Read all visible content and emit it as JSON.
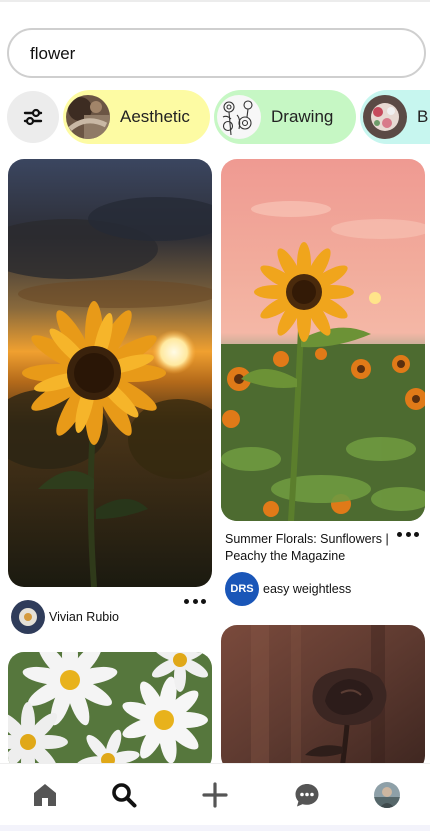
{
  "search": {
    "value": "flower",
    "placeholder": ""
  },
  "chips": [
    {
      "label": "Aesthetic",
      "color": "#fdfba3"
    },
    {
      "label": "Drawing",
      "color": "#c6f7c4"
    },
    {
      "label": "B",
      "color": "#c7f6ef"
    }
  ],
  "pins": [
    {
      "image": "sunflower-sunset",
      "author": "Vivian Rubio"
    },
    {
      "image": "sunflower-field-pink-sky",
      "title": "Summer Florals: Sunflowers | Peachy the Magazine",
      "author": "easy weightless",
      "author_avatar_text": "DRS"
    },
    {
      "image": "white-daisies"
    },
    {
      "image": "rose-shadow"
    }
  ],
  "nav": [
    {
      "icon": "home-icon"
    },
    {
      "icon": "search-icon",
      "active": true
    },
    {
      "icon": "plus-icon"
    },
    {
      "icon": "chat-icon"
    },
    {
      "icon": "profile-avatar"
    }
  ],
  "colors": {
    "accent_blue": "#1a56b8",
    "nav_icon": "#555555",
    "active_icon": "#111111"
  }
}
